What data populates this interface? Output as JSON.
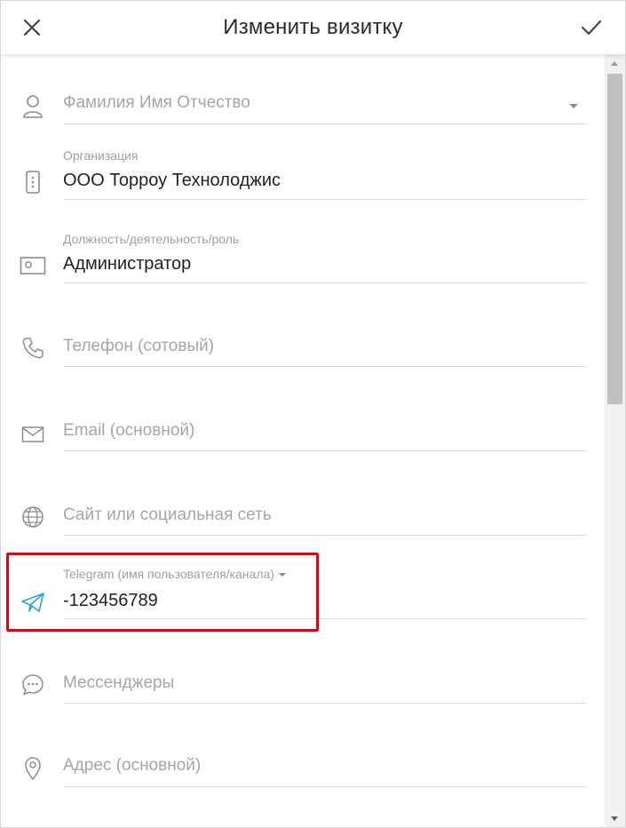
{
  "header": {
    "title": "Изменить визитку",
    "close_icon": "close-icon",
    "confirm_icon": "checkmark-icon"
  },
  "fields": {
    "full_name": {
      "placeholder": "Фамилия Имя Отчество",
      "icon": "person-icon"
    },
    "organization": {
      "label": "Организация",
      "value": "ООО Торроу Технолоджис",
      "icon": "building-icon"
    },
    "position": {
      "label": "Должность/деятельность/роль",
      "value": "Администратор",
      "icon": "id-card-icon"
    },
    "phone": {
      "placeholder": "Телефон (сотовый)",
      "icon": "phone-icon"
    },
    "email": {
      "placeholder": "Email (основной)",
      "icon": "envelope-icon"
    },
    "website": {
      "placeholder": "Сайт или социальная сеть",
      "icon": "globe-icon"
    },
    "telegram": {
      "label": "Telegram (имя пользователя/канала)",
      "value": "-123456789",
      "icon": "telegram-icon"
    },
    "messengers": {
      "placeholder": "Мессенджеры",
      "icon": "chat-icon"
    },
    "address": {
      "placeholder": "Адрес (основной)",
      "icon": "location-pin-icon"
    }
  },
  "colors": {
    "highlight": "#e60012",
    "telegram_icon": "#2aa3d6",
    "icon_gray": "#8c8c8c"
  }
}
